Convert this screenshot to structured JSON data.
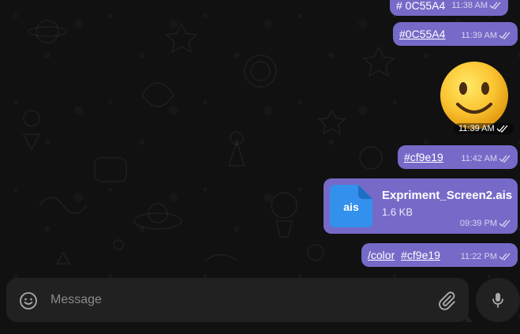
{
  "colors": {
    "bubble": "#766ac8",
    "background": "#0e0e0e",
    "composer": "#212121",
    "file_icon": "#3390ec"
  },
  "messages": [
    {
      "text": "# 0C55A4",
      "time": "11:38 AM",
      "status": "read"
    },
    {
      "text": "#0C55A4",
      "time": "11:39 AM",
      "status": "read"
    },
    {
      "sticker": "slightly-smiling-face-emoji",
      "time": "11:39 AM",
      "status": "read"
    },
    {
      "text": "#cf9e19",
      "time": "11:42 AM",
      "status": "read"
    },
    {
      "file": {
        "name": "Expriment_Screen2.ais",
        "size": "1.6 KB",
        "ext": "ais"
      },
      "time": "09:39 PM",
      "status": "read"
    },
    {
      "command": "/color",
      "text": "#cf9e19",
      "time": "11:22 PM",
      "status": "read"
    }
  ],
  "composer": {
    "placeholder": "Message",
    "value": ""
  },
  "icons": {
    "emoji": "smile-icon",
    "attach": "paperclip-icon",
    "mic": "microphone-icon",
    "status": "double-check-icon"
  }
}
